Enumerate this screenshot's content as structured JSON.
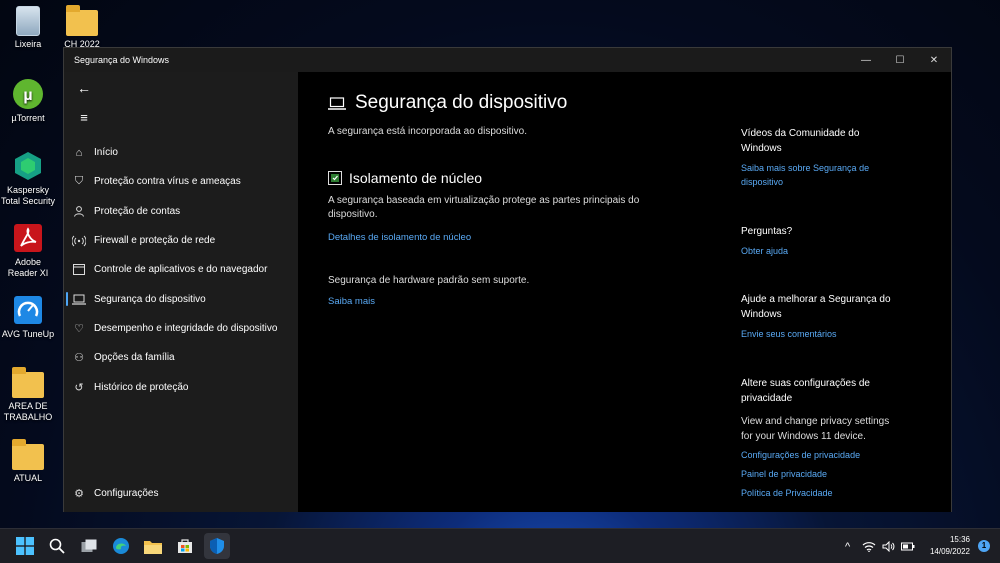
{
  "desktop": {
    "icons": [
      {
        "label": "Lixeira"
      },
      {
        "label": "CH 2022"
      },
      {
        "label": "µTorrent"
      },
      {
        "label": "Kaspersky Total Security"
      },
      {
        "label": "Adobe Reader XI"
      },
      {
        "label": "AVG TuneUp"
      },
      {
        "label": "AREA DE TRABALHO"
      },
      {
        "label": "ATUAL"
      }
    ]
  },
  "window": {
    "title": "Segurança do Windows",
    "controls": {
      "minimize": "—",
      "maximize": "☐",
      "close": "✕"
    }
  },
  "sidebar": {
    "back_icon": "←",
    "menu_icon": "≡",
    "items": [
      {
        "label": "Início",
        "icon": "home-icon",
        "glyph": "⌂"
      },
      {
        "label": "Proteção contra vírus e ameaças",
        "icon": "shield-icon",
        "glyph": "⛉"
      },
      {
        "label": "Proteção de contas",
        "icon": "person-icon",
        "glyph": "👤"
      },
      {
        "label": "Firewall e proteção de rede",
        "icon": "wifi-icon",
        "glyph": "((·))"
      },
      {
        "label": "Controle de aplicativos e do navegador",
        "icon": "app-window-icon",
        "glyph": "▭"
      },
      {
        "label": "Segurança do dispositivo",
        "icon": "laptop-icon",
        "glyph": "💻",
        "active": true
      },
      {
        "label": "Desempenho e integridade do dispositivo",
        "icon": "heart-icon",
        "glyph": "♡"
      },
      {
        "label": "Opções da família",
        "icon": "family-icon",
        "glyph": "⚇"
      },
      {
        "label": "Histórico de proteção",
        "icon": "history-icon",
        "glyph": "↺"
      }
    ],
    "settings": {
      "label": "Configurações",
      "icon": "gear-icon",
      "glyph": "⚙"
    }
  },
  "main": {
    "title": "Segurança do dispositivo",
    "subtitle": "A segurança está incorporada ao dispositivo.",
    "core_isolation": {
      "title": "Isolamento de núcleo",
      "description": "A segurança baseada em virtualização protege as partes principais do dispositivo.",
      "link": "Detalhes de isolamento de núcleo"
    },
    "hardware": {
      "text": "Segurança de hardware padrão sem suporte.",
      "link": "Saiba mais"
    },
    "right": {
      "community": {
        "heading": "Vídeos da Comunidade do Windows",
        "link": "Saiba mais sobre Segurança de dispositivo"
      },
      "questions": {
        "heading": "Perguntas?",
        "link": "Obter ajuda"
      },
      "improve": {
        "heading": "Ajude a melhorar a Segurança do Windows",
        "link": "Envie seus comentários"
      },
      "privacy": {
        "heading": "Altere suas configurações de privacidade",
        "text": "View and change privacy settings for your Windows 11 device.",
        "links": [
          "Configurações de privacidade",
          "Painel de privacidade",
          "Política de Privacidade"
        ]
      }
    }
  },
  "taskbar": {
    "tray": {
      "chevron": "^",
      "wifi": "wifi-icon",
      "volume": "volume-icon",
      "battery": "battery-icon"
    },
    "time": "15:36",
    "date": "14/09/2022",
    "notification_count": "1"
  },
  "colors": {
    "accent": "#4ea5f5",
    "link": "#5aaaf5",
    "sidebar_bg": "#1c1c1c",
    "main_bg": "#000000"
  }
}
